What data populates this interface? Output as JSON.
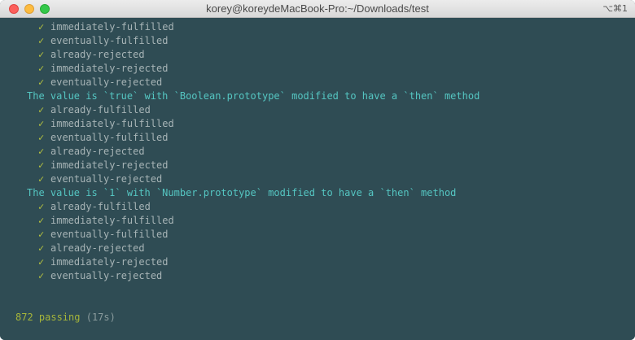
{
  "window": {
    "title": "korey@koreydeMacBook-Pro:~/Downloads/test",
    "shortcut": "⌥⌘1"
  },
  "colors": {
    "background": "#2f4c54",
    "check": "#b5c23f",
    "test_name": "#a7b4b6",
    "suite_title": "#55c6c2",
    "summary": "#a6b53a"
  },
  "output": {
    "check_glyph": "✓",
    "block1": {
      "tests": [
        "immediately-fulfilled",
        "eventually-fulfilled",
        "already-rejected",
        "immediately-rejected",
        "eventually-rejected"
      ]
    },
    "block2": {
      "title": "The value is `true` with `Boolean.prototype` modified to have a `then` method",
      "tests": [
        "already-fulfilled",
        "immediately-fulfilled",
        "eventually-fulfilled",
        "already-rejected",
        "immediately-rejected",
        "eventually-rejected"
      ]
    },
    "block3": {
      "title": "The value is `1` with `Number.prototype` modified to have a `then` method",
      "tests": [
        "already-fulfilled",
        "immediately-fulfilled",
        "eventually-fulfilled",
        "already-rejected",
        "immediately-rejected",
        "eventually-rejected"
      ]
    },
    "summary": {
      "passing": "872 passing",
      "time": "(17s)"
    }
  }
}
